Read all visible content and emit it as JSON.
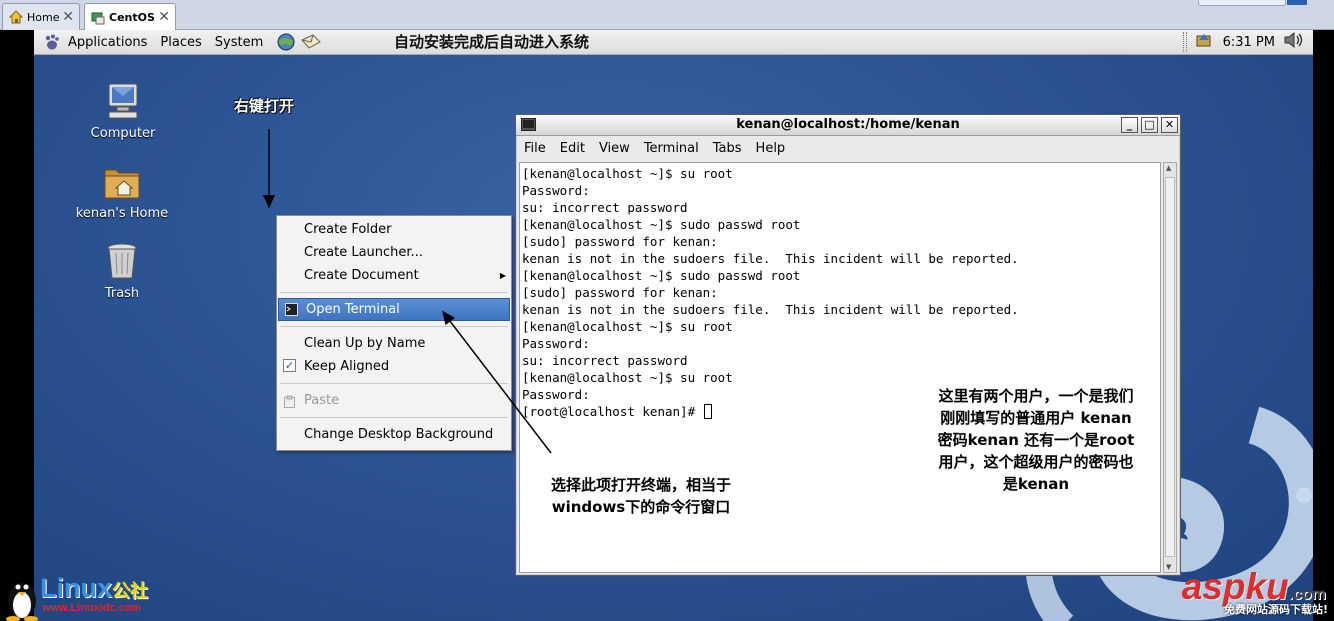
{
  "host_tabs": [
    {
      "label": "Home",
      "icon": "home-icon"
    },
    {
      "label": "CentOS",
      "icon": "vm-icon"
    }
  ],
  "panel": {
    "menus": [
      "Applications",
      "Places",
      "System"
    ],
    "annotation": "自动安装完成后自动进入系统",
    "clock": "6:31 PM"
  },
  "desktop_icons": [
    {
      "label": "Computer",
      "icon": "computer-icon"
    },
    {
      "label": "kenan's Home",
      "icon": "home-folder-icon"
    },
    {
      "label": "Trash",
      "icon": "trash-icon"
    }
  ],
  "annotations": {
    "right_click": "右键打开",
    "choose_item": [
      "选择此项打开终端，相当于",
      "windows下的命令行窗口"
    ],
    "users_note": [
      "这里有两个用户，一个是我们",
      "刚刚填写的普通用户 kenan",
      "密码kenan 还有一个是root",
      "用户，这个超级用户的密码也",
      "是kenan"
    ]
  },
  "context_menu": {
    "items": [
      {
        "label": "Create Folder"
      },
      {
        "label": "Create Launcher..."
      },
      {
        "label": "Create Document",
        "submenu": true
      },
      {
        "label": "Open Terminal",
        "selected": true
      },
      {
        "label": "Clean Up by Name"
      },
      {
        "label": "Keep Aligned",
        "checked": true
      },
      {
        "label": "Paste",
        "disabled": true
      },
      {
        "label": "Change Desktop Background"
      }
    ]
  },
  "terminal": {
    "title": "kenan@localhost:/home/kenan",
    "menu": [
      "File",
      "Edit",
      "View",
      "Terminal",
      "Tabs",
      "Help"
    ],
    "lines": [
      "[kenan@localhost ~]$ su root",
      "Password:",
      "su: incorrect password",
      "[kenan@localhost ~]$ sudo passwd root",
      "[sudo] password for kenan:",
      "kenan is not in the sudoers file.  This incident will be reported.",
      "[kenan@localhost ~]$ sudo passwd root",
      "[sudo] password for kenan:",
      "kenan is not in the sudoers file.  This incident will be reported.",
      "[kenan@localhost ~]$ su root",
      "Password:",
      "su: incorrect password",
      "[kenan@localhost ~]$ su root",
      "Password:",
      "[root@localhost kenan]# "
    ]
  },
  "watermarks": {
    "linux_brand": "Linux",
    "linux_brand_cn": "公社",
    "linux_url": "www.Linuxidc.com",
    "asp_brand": "aspku",
    "asp_suffix": ".com",
    "asp_tag": "免费网站源码下载站!"
  },
  "colors": {
    "desktop": "#2c5393",
    "menu_highlight": "#3e74c1",
    "panel": "#e4e4e4"
  }
}
